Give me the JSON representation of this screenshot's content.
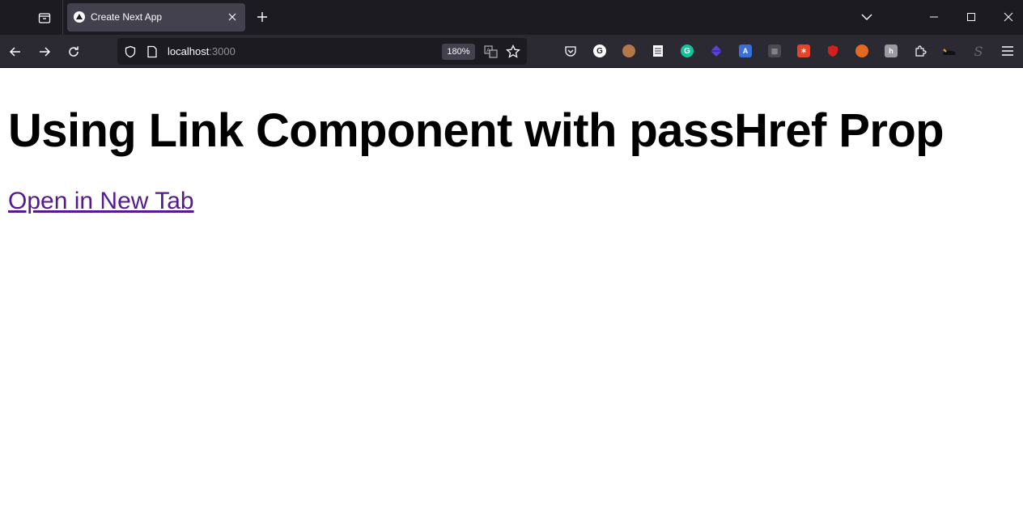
{
  "browser": {
    "tab": {
      "title": "Create Next App"
    },
    "address_bar": {
      "host": "localhost",
      "port": ":3000",
      "zoom": "180%"
    },
    "toolbar_icons": {
      "list_all_tabs": "tab-list-icon",
      "back": "back-arrow-icon",
      "forward": "forward-arrow-icon",
      "reload": "reload-icon",
      "tracking_protection": "shield-icon",
      "page_info": "page-icon",
      "translate": "translate-icon",
      "bookmark": "star-icon",
      "menu": "hamburger-menu-icon"
    },
    "extensions": [
      {
        "name": "pocket-icon"
      },
      {
        "name": "g-extension-icon",
        "glyph": "G"
      },
      {
        "name": "cookie-icon"
      },
      {
        "name": "notes-icon"
      },
      {
        "name": "grammarly-icon"
      },
      {
        "name": "diamond-extension-icon"
      },
      {
        "name": "translate-extension-icon"
      },
      {
        "name": "grid-extension-icon"
      },
      {
        "name": "red-extension-icon"
      },
      {
        "name": "ublock-icon"
      },
      {
        "name": "fox-extension-icon"
      },
      {
        "name": "gray-extension-icon"
      },
      {
        "name": "puzzle-extensions-icon"
      },
      {
        "name": "whale-extension-icon"
      },
      {
        "name": "s-extension-icon",
        "glyph": "S"
      }
    ]
  },
  "page": {
    "heading": "Using Link Component with passHref Prop",
    "link_text": "Open in New Tab"
  },
  "colors": {
    "tabstrip_bg": "#1c1b22",
    "navbar_bg": "#2b2a33",
    "active_tab_bg": "#42414d",
    "link_visited": "#551a8b"
  }
}
